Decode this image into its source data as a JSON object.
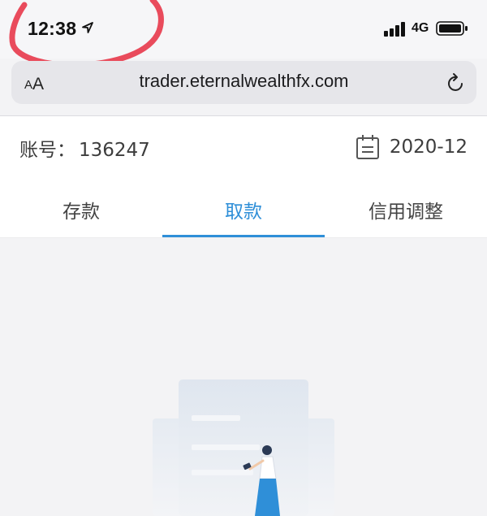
{
  "status_bar": {
    "time": "12:38",
    "network": "4G"
  },
  "browser": {
    "text_size_small": "A",
    "text_size_large": "A",
    "url": "trader.eternalwealthfx.com"
  },
  "account": {
    "label": "账号：",
    "number": "136247"
  },
  "date_filter": {
    "value": "2020-12"
  },
  "tabs": [
    {
      "label": "存款",
      "active": false
    },
    {
      "label": "取款",
      "active": true
    },
    {
      "label": "信用调整",
      "active": false
    }
  ],
  "colors": {
    "accent": "#2f8fd8",
    "annotation": "#e8384a"
  }
}
